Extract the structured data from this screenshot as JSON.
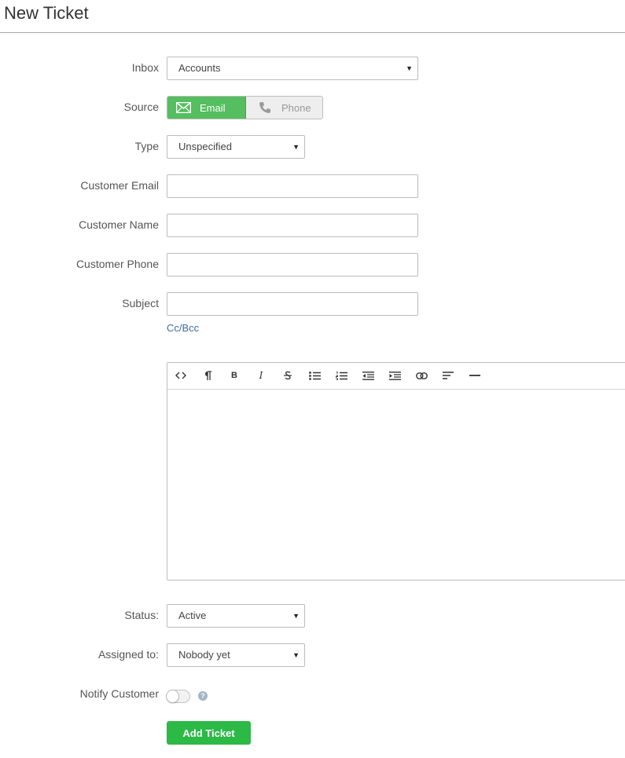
{
  "header": {
    "title": "New Ticket"
  },
  "form": {
    "inbox": {
      "label": "Inbox",
      "value": "Accounts"
    },
    "source": {
      "label": "Source",
      "options": [
        "Email",
        "Phone"
      ],
      "selected": "Email"
    },
    "type": {
      "label": "Type",
      "value": "Unspecified"
    },
    "customer_email": {
      "label": "Customer Email",
      "value": ""
    },
    "customer_name": {
      "label": "Customer Name",
      "value": ""
    },
    "customer_phone": {
      "label": "Customer Phone",
      "value": ""
    },
    "subject": {
      "label": "Subject",
      "value": "",
      "cc_bcc_link": "Cc/Bcc"
    },
    "editor": {
      "toolbar": [
        "code-icon",
        "paragraph-icon",
        "bold-icon",
        "italic-icon",
        "strikethrough-icon",
        "bullet-list-icon",
        "numbered-list-icon",
        "outdent-icon",
        "indent-icon",
        "link-icon",
        "align-left-icon",
        "horizontal-rule-icon"
      ],
      "body": ""
    },
    "status": {
      "label": "Status:",
      "value": "Active"
    },
    "assigned_to": {
      "label": "Assigned to:",
      "value": "Nobody yet"
    },
    "notify_customer": {
      "label": "Notify Customer",
      "enabled": false,
      "help_icon": "?"
    },
    "submit_label": "Add Ticket"
  },
  "colors": {
    "accent": "#55be5f",
    "submit": "#2cb946",
    "link": "#3c6ea8"
  }
}
